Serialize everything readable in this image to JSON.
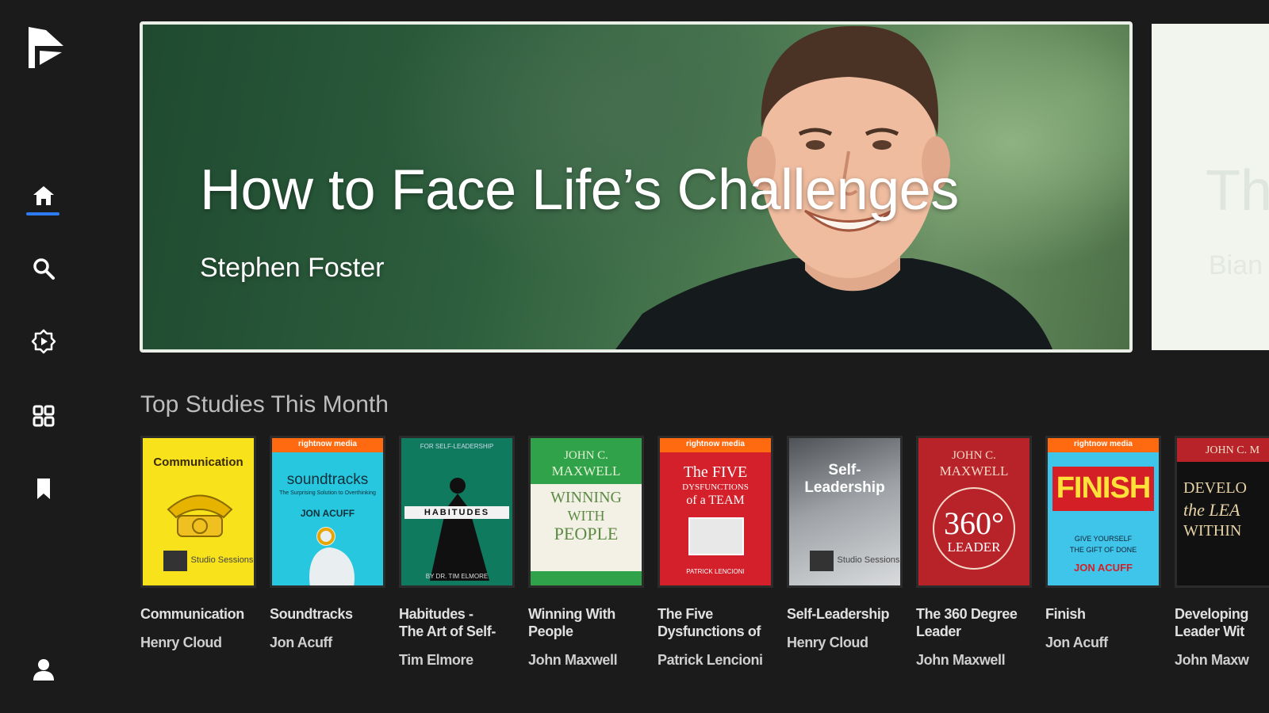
{
  "nav": {
    "items": [
      {
        "name": "home",
        "icon": "home-icon",
        "active": true
      },
      {
        "name": "search",
        "icon": "search-icon"
      },
      {
        "name": "plans",
        "icon": "badge-play-icon"
      },
      {
        "name": "browse",
        "icon": "grid-icon"
      },
      {
        "name": "saved",
        "icon": "bookmark-icon"
      },
      {
        "name": "profile",
        "icon": "person-icon"
      }
    ],
    "active_color": "#2d7cf6"
  },
  "hero": {
    "title": "How to Face Life’s Challenges",
    "subtitle": "Stephen Foster"
  },
  "hero_next": {
    "title": "Th",
    "subtitle": "Bian"
  },
  "section": {
    "title": "Top Studies This Month"
  },
  "studies": [
    {
      "title": "Communication",
      "author": "Henry Cloud",
      "cover": {
        "bg": "#f7e21b",
        "line1": "Communication",
        "badge": "Studio Sessions"
      }
    },
    {
      "title": "Soundtracks",
      "author": "Jon Acuff",
      "cover": {
        "bg": "#27c7e0",
        "band": "rightnow media",
        "line1": "soundtracks",
        "line2": "The Surprising Solution to Overthinking",
        "line3": "JON ACUFF"
      }
    },
    {
      "title": "Habitudes -\nThe Art of Self-L...",
      "author": "Tim Elmore",
      "cover": {
        "bg": "#0f7a5e",
        "line1": "FOR SELF-LEADERSHIP",
        "line2": "HABITUDES",
        "line3": "BY DR. TIM ELMORE"
      }
    },
    {
      "title": "Winning With\nPeople",
      "author": "John Maxwell",
      "cover": {
        "bg": "#2fa24a",
        "line1": "JOHN C.",
        "line2": "MAXWELL",
        "line3": "WINNING",
        "line4": "WITH",
        "line5": "PEOPLE"
      }
    },
    {
      "title": "The Five\nDysfunctions of ...",
      "author": "Patrick Lencioni",
      "cover": {
        "bg": "#d3202a",
        "band": "rightnow media",
        "line1": "The FIVE",
        "line2": "DYSFUNCTIONS",
        "line3": "of a TEAM",
        "line4": "PATRICK LENCIONI"
      }
    },
    {
      "title": "Self-Leadership",
      "author": "Henry Cloud",
      "cover": {
        "bg": "#9ea2a6",
        "line1": "Self-",
        "line2": "Leadership",
        "badge": "Studio Sessions"
      }
    },
    {
      "title": "The 360 Degree\nLeader",
      "author": "John Maxwell",
      "cover": {
        "bg": "#b8232a",
        "line1": "JOHN C.",
        "line2": "MAXWELL",
        "line3": "360°",
        "line4": "LEADER"
      }
    },
    {
      "title": "Finish",
      "author": "Jon Acuff",
      "cover": {
        "bg": "#3fc4ea",
        "band": "rightnow media",
        "line1": "FINISH",
        "line2": "GIVE YOURSELF",
        "line3": "THE GIFT OF DONE",
        "line4": "JON ACUFF"
      }
    },
    {
      "title": "Developing\nLeader Wit",
      "author": "John Maxw",
      "cover": {
        "bg": "#111111",
        "line1": "JOHN C. M",
        "line2": "DEVELO",
        "line3": "the LEA",
        "line4": "WITHIN"
      }
    }
  ]
}
